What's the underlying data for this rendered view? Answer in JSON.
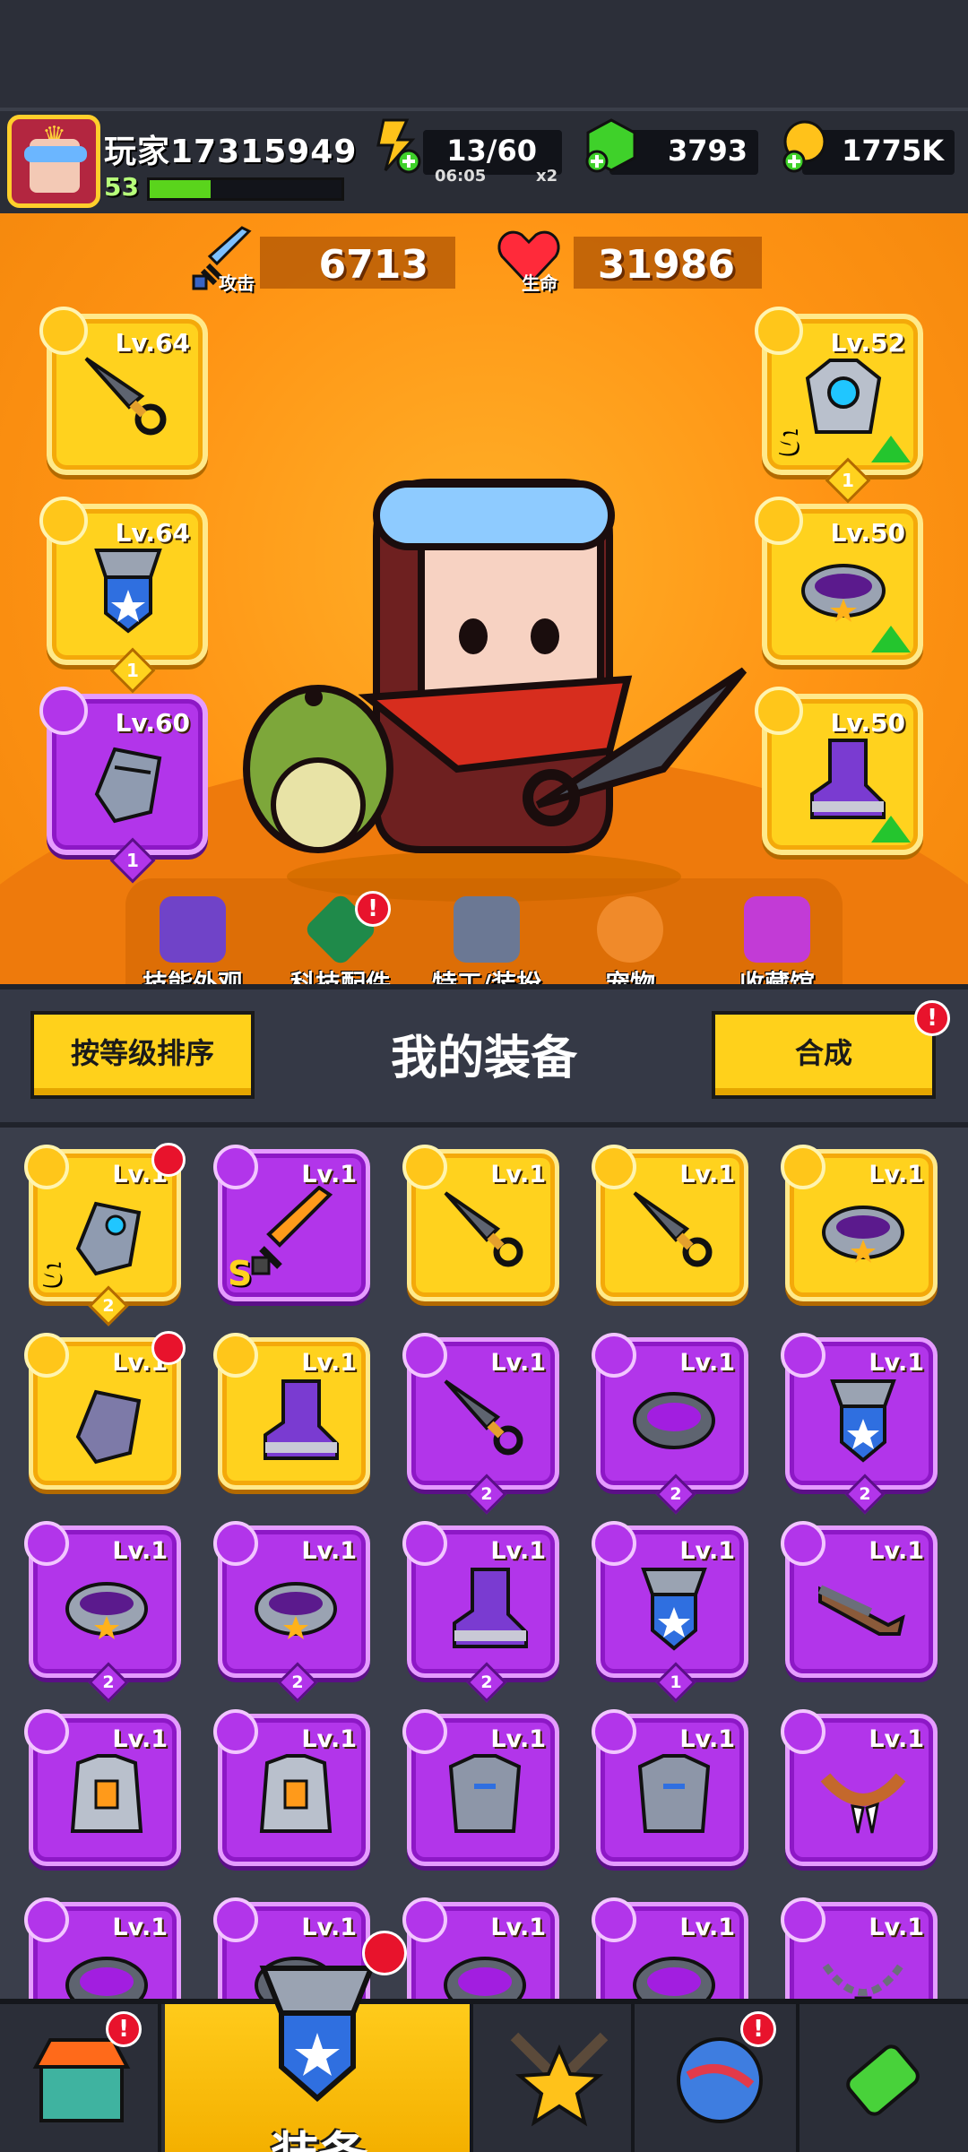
{
  "player": {
    "name": "玩家17315949",
    "level": "53",
    "xp_fraction": 0.32
  },
  "resources": {
    "energy": {
      "value": "13/60",
      "timer": "06:05",
      "multiplier": "x2",
      "icon": "energy-icon"
    },
    "gems": {
      "value": "3793",
      "icon": "green-gem-icon"
    },
    "coins": {
      "value": "1775K",
      "icon": "gold-coin-icon"
    }
  },
  "stats": {
    "attack": {
      "label": "攻击",
      "value": "6713"
    },
    "hp": {
      "label": "生命",
      "value": "31986"
    }
  },
  "equipped": [
    {
      "slot": "weapon",
      "level": "Lv.64",
      "rarity": "gold",
      "icon": "kunai-icon"
    },
    {
      "slot": "necklace",
      "level": "Lv.64",
      "rarity": "gold",
      "icon": "shield-necklace-icon",
      "count": "1"
    },
    {
      "slot": "gloves",
      "level": "Lv.60",
      "rarity": "purple",
      "icon": "gauntlet-icon",
      "count": "1"
    },
    {
      "slot": "armor",
      "level": "Lv.52",
      "rarity": "gold",
      "icon": "robot-armor-icon",
      "grade": "S",
      "count": "1",
      "upgrade": true
    },
    {
      "slot": "belt",
      "level": "Lv.50",
      "rarity": "gold",
      "icon": "belt-icon",
      "upgrade": true
    },
    {
      "slot": "boots",
      "level": "Lv.50",
      "rarity": "gold",
      "icon": "boots-icon",
      "upgrade": true
    }
  ],
  "hero_nav": [
    {
      "label": "技能外观",
      "icon": "skill-skin-icon"
    },
    {
      "label": "科技配件",
      "icon": "tech-part-icon",
      "alert": "!"
    },
    {
      "label": "特工/装扮",
      "icon": "agent-icon"
    },
    {
      "label": "宠物",
      "icon": "pet-icon"
    },
    {
      "label": "收藏馆",
      "icon": "collection-icon"
    }
  ],
  "panel": {
    "sort_label": "按等级排序",
    "title": "我的装备",
    "merge_label": "合成",
    "merge_alert": "!"
  },
  "inventory": [
    {
      "level": "Lv.1",
      "rarity": "gold",
      "icon": "gauntlet-icon",
      "grade": "S",
      "count": "2",
      "marked": true
    },
    {
      "level": "Lv.1",
      "rarity": "purple",
      "icon": "sword-icon",
      "grade": "S"
    },
    {
      "level": "Lv.1",
      "rarity": "gold",
      "icon": "kunai-icon"
    },
    {
      "level": "Lv.1",
      "rarity": "gold",
      "icon": "kunai-icon"
    },
    {
      "level": "Lv.1",
      "rarity": "gold",
      "icon": "belt-icon"
    },
    {
      "level": "Lv.1",
      "rarity": "gold",
      "icon": "glove-icon",
      "marked": true
    },
    {
      "level": "Lv.1",
      "rarity": "gold",
      "icon": "boots-icon"
    },
    {
      "level": "Lv.1",
      "rarity": "purple",
      "icon": "kunai-icon",
      "count": "2"
    },
    {
      "level": "Lv.1",
      "rarity": "purple",
      "icon": "spiked-collar-icon",
      "count": "2"
    },
    {
      "level": "Lv.1",
      "rarity": "purple",
      "icon": "shield-necklace-icon",
      "count": "2"
    },
    {
      "level": "Lv.1",
      "rarity": "purple",
      "icon": "belt-icon",
      "count": "2"
    },
    {
      "level": "Lv.1",
      "rarity": "purple",
      "icon": "belt-icon",
      "count": "2"
    },
    {
      "level": "Lv.1",
      "rarity": "purple",
      "icon": "boots-icon",
      "count": "2"
    },
    {
      "level": "Lv.1",
      "rarity": "purple",
      "icon": "shield-necklace-icon",
      "count": "1"
    },
    {
      "level": "Lv.1",
      "rarity": "purple",
      "icon": "shotgun-icon"
    },
    {
      "level": "Lv.1",
      "rarity": "purple",
      "icon": "vest-icon"
    },
    {
      "level": "Lv.1",
      "rarity": "purple",
      "icon": "vest-icon"
    },
    {
      "level": "Lv.1",
      "rarity": "purple",
      "icon": "chest-armor-icon"
    },
    {
      "level": "Lv.1",
      "rarity": "purple",
      "icon": "chest-armor-icon"
    },
    {
      "level": "Lv.1",
      "rarity": "purple",
      "icon": "fang-necklace-icon"
    },
    {
      "level": "Lv.1",
      "rarity": "purple",
      "icon": "spiked-collar-icon"
    },
    {
      "level": "Lv.1",
      "rarity": "purple",
      "icon": "spiked-collar-icon"
    },
    {
      "level": "Lv.1",
      "rarity": "purple",
      "icon": "spiked-collar-icon"
    },
    {
      "level": "Lv.1",
      "rarity": "purple",
      "icon": "spiked-collar-icon"
    },
    {
      "level": "Lv.1",
      "rarity": "purple",
      "icon": "chain-necklace-icon"
    }
  ],
  "bottom_nav": [
    {
      "icon": "shop-icon",
      "alert": "!"
    },
    {
      "label": "装备",
      "icon": "equipment-icon",
      "active": true
    },
    {
      "icon": "battle-star-icon"
    },
    {
      "icon": "planet-icon",
      "alert": "!"
    },
    {
      "icon": "dna-capsule-icon"
    }
  ],
  "colors": {
    "gold": "#ffd21e",
    "purple": "#b235ea",
    "hero_bg": "#ff9414",
    "alert": "#e8132c"
  }
}
